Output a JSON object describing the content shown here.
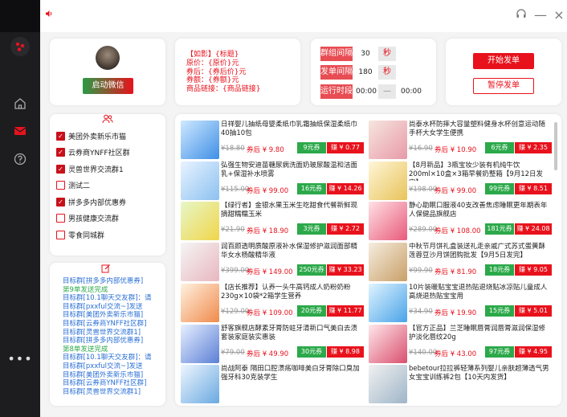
{
  "app": {
    "accent": "#e8121c",
    "green": "#2ca94a"
  },
  "sidebar": {
    "items": [
      {
        "icon": "logo-icon"
      },
      {
        "icon": "home-icon"
      },
      {
        "icon": "mail-icon"
      },
      {
        "icon": "help-icon"
      },
      {
        "icon": "more-icon"
      }
    ]
  },
  "account": {
    "button": "启动微信"
  },
  "template": {
    "lines": [
      "【如影】{标题}",
      "原价：{原价}元",
      "券后：{券后价}元",
      "券额：{券额}元",
      "商品链接：{商品链接}"
    ]
  },
  "config": {
    "interval": {
      "label": "群组间隔",
      "value": "30",
      "unit": "秒"
    },
    "send_interval": {
      "label": "发单间隔",
      "value": "180",
      "unit": "秒"
    },
    "run_time": {
      "label": "运行时段",
      "start": "00:00",
      "sep": "—",
      "end": "00:00"
    }
  },
  "actions": {
    "start": "开始发单",
    "pause": "暂停发单"
  },
  "groups": [
    {
      "name": "美团外卖新乐市猫",
      "checked": true
    },
    {
      "name": "云券商YNFF社区群",
      "checked": true
    },
    {
      "name": "灵兽世界交流群1",
      "checked": true
    },
    {
      "name": "测试二",
      "checked": false
    },
    {
      "name": "拼多多内部优惠券",
      "checked": true
    },
    {
      "name": "男孩健康交流群",
      "checked": false
    },
    {
      "name": "零食同城群",
      "checked": false
    }
  ],
  "log": [
    {
      "text": "目标群[拼多多内部优惠券]",
      "type": "blue"
    },
    {
      "text": "第9单发送完成",
      "type": "green"
    },
    {
      "text": "目标群[10.1聊天交友群]：请",
      "type": "blue"
    },
    {
      "text": "目标群[pxxful交流~]发送",
      "type": "blue"
    },
    {
      "text": "目标群[美团外卖新乐市猫]",
      "type": "blue"
    },
    {
      "text": "目标群[云券商YNFF社区群]",
      "type": "blue"
    },
    {
      "text": "目标群[灵兽世界交流群1]",
      "type": "blue"
    },
    {
      "text": "目标群[拼多多内部优惠券]",
      "type": "blue"
    },
    {
      "text": "第8单发送完成",
      "type": "green"
    },
    {
      "text": "目标群[10.1聊天交友群]：请",
      "type": "blue"
    },
    {
      "text": "目标群[pxxful交流~]发送",
      "type": "blue"
    },
    {
      "text": "目标群[美团外卖新乐市猫]",
      "type": "blue"
    },
    {
      "text": "目标群[云券商YNFF社区群]",
      "type": "blue"
    },
    {
      "text": "目标群[灵兽世界交流群1]",
      "type": "blue"
    }
  ],
  "products": [
    {
      "title": "日祥婴儿抽纸母婴柔纸巾乳霜抽纸保湿柔纸巾40抽10包",
      "orig": "¥18.80",
      "after": "券后 ¥ 9.80",
      "coupon": "9元券",
      "earn": "赚 ¥ 0.77"
    },
    {
      "title": "尚泰水杯防摔大容量塑料健身水杯创意运动随手杯大女学生便携",
      "orig": "¥16.90",
      "after": "券后 ¥ 10.90",
      "coupon": "6元券",
      "earn": "赚 ¥ 2.35"
    },
    {
      "title": "弘强生物安迪苗糖尿病洗面奶玻尿酸温和洁面乳+保湿补水喷雾",
      "orig": "¥115.00",
      "after": "券后 ¥ 99.00",
      "coupon": "16元券",
      "earn": "赚 ¥ 14.26"
    },
    {
      "title": "【8月新品】3瓶宝妆少装有机纯牛饮200ml×10盒×3箱早餐奶整箱【9月12日发完】",
      "orig": "¥198.00",
      "after": "券后 ¥ 99.00",
      "coupon": "99元券",
      "earn": "赚 ¥ 8.51"
    },
    {
      "title": "【绿行者】金银水果玉米生吃甜食代餐新鲜现摘甜糯糯玉米",
      "orig": "¥21.90",
      "after": "券后 ¥ 18.90",
      "coupon": "3元券",
      "earn": "赚 ¥ 2.72"
    },
    {
      "title": "静心助眠口服液40支改善焦虑睡眠更年期表年人保健品旗舰店",
      "orig": "¥289.00",
      "after": "券后 ¥ 108.00",
      "coupon": "181元券",
      "earn": "赚 ¥ 24.08"
    },
    {
      "title": "润百颜透明质酸原液补水保湿修护滋润面部精华女水杨酸精华液",
      "orig": "¥399.00",
      "after": "券后 ¥ 149.00",
      "coupon": "250元券",
      "earn": "赚 ¥ 33.23"
    },
    {
      "title": "中秋节月饼礼盒装送礼走亲戚广式苏式蛋黄酥莲蓉豆沙月饼团购批发【9月5日发完】",
      "orig": "¥99.90",
      "after": "券后 ¥ 81.90",
      "coupon": "18元券",
      "earn": "赚 ¥ 9.05"
    },
    {
      "title": "【店长推荐】认养一头牛高钙成人奶粉奶粉230g×10袋*2箱学生营养",
      "orig": "¥129.00",
      "after": "券后 ¥ 109.00",
      "coupon": "20元券",
      "earn": "赚 ¥ 11.77"
    },
    {
      "title": "10片装暖贴宝宝退热贴退烧贴冰凉贴儿童成人高烧退热贴宝宝用",
      "orig": "¥34.90",
      "after": "券后 ¥ 19.90",
      "coupon": "15元券",
      "earn": "赚 ¥ 5.01"
    },
    {
      "title": "舒客旗舰店酵素牙膏防蛀牙清新口气美白去渍套装家庭装实惠装",
      "orig": "¥79.00",
      "after": "券后 ¥ 49.90",
      "coupon": "30元券",
      "earn": "赚 ¥ 8.98"
    },
    {
      "title": "【官方正品】兰芝睡眠唇膏润唇膏滋润保湿修护淡化唇纹20g",
      "orig": "¥140.00",
      "after": "券后 ¥ 43.00",
      "coupon": "97元券",
      "earn": "赚 ¥ 4.95"
    },
    {
      "title": "尚战阿泰 隔田口腔溃疡咖啡美白牙膏除口臭加强牙科30克装学生",
      "orig": "",
      "after": "",
      "coupon": "",
      "earn": ""
    },
    {
      "title": "bebetour拉拉裤轻薄系列婴儿亲肤超薄透气男女宝宝训练裤2包【10天内发货】",
      "orig": "",
      "after": "",
      "coupon": "",
      "earn": ""
    }
  ]
}
